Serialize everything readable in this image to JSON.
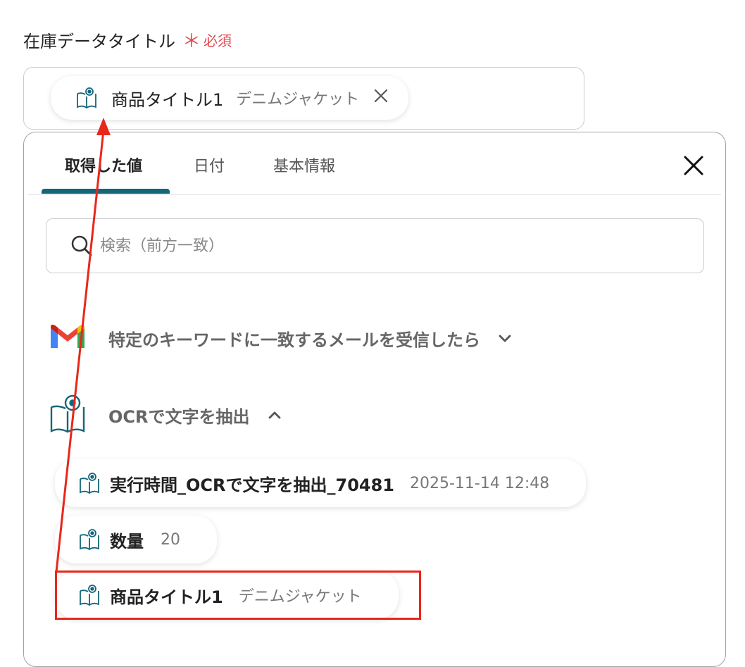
{
  "field": {
    "label": "在庫データタイトル",
    "required_star": "＊",
    "required_text": "必須",
    "chip": {
      "title": "商品タイトル1",
      "value": "デニムジャケット"
    }
  },
  "panel": {
    "tabs": [
      {
        "label": "取得した値",
        "active": true
      },
      {
        "label": "日付",
        "active": false
      },
      {
        "label": "基本情報",
        "active": false
      }
    ],
    "search": {
      "placeholder": "検索（前方一致）",
      "value": ""
    },
    "sections": [
      {
        "title": "特定のキーワードに一致するメールを受信したら",
        "icon": "gmail-icon",
        "expanded": false
      },
      {
        "title": "OCRで文字を抽出",
        "icon": "ocr-book-icon",
        "expanded": true
      }
    ],
    "items": [
      {
        "title": "実行時間_OCRで文字を抽出_70481",
        "value": "2025-11-14 12:48"
      },
      {
        "title": "数量",
        "value": "20"
      },
      {
        "title": "商品タイトル1",
        "value": "デニムジャケット"
      }
    ]
  },
  "colors": {
    "accent": "#14667a",
    "required": "#e5484d",
    "annotation": "#e8271a"
  }
}
